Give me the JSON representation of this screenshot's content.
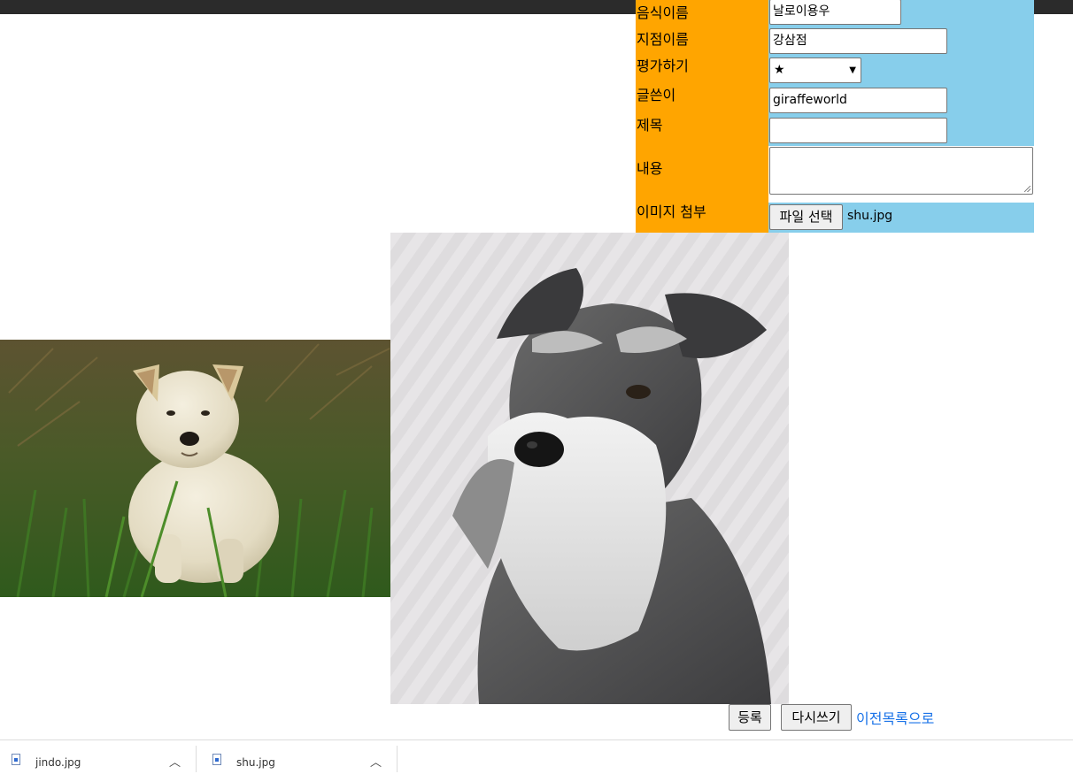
{
  "form": {
    "rows": [
      {
        "label": "음식이름",
        "value": "날로이용우"
      },
      {
        "label": "지점이름",
        "value": "강삼점"
      },
      {
        "label": "평가하기",
        "value": "★"
      },
      {
        "label": "글쓴이",
        "value": "giraffeworld"
      },
      {
        "label": "제목",
        "value": ""
      },
      {
        "label": "내용",
        "value": ""
      },
      {
        "label": "이미지 첨부",
        "file_button": "파일 선택",
        "file_name": "shu.jpg"
      }
    ]
  },
  "images": [
    {
      "name": "jindo-puppy-photo"
    },
    {
      "name": "schnauzer-photo"
    }
  ],
  "actions": {
    "submit": "등록",
    "reset": "다시쓰기",
    "back_link": "이전목록으로"
  },
  "downloads": [
    {
      "file": "jindo.jpg"
    },
    {
      "file": "shu.jpg"
    }
  ]
}
